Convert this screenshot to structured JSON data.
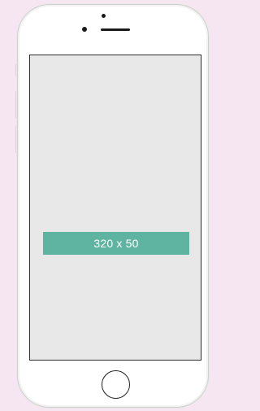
{
  "banner": {
    "size_label": "320 x 50"
  },
  "colors": {
    "page_background": "#f6e6f2",
    "device_body": "#ffffff",
    "screen": "#e8e8e8",
    "banner": "#5fb4a1",
    "banner_text": "#ffffff"
  }
}
